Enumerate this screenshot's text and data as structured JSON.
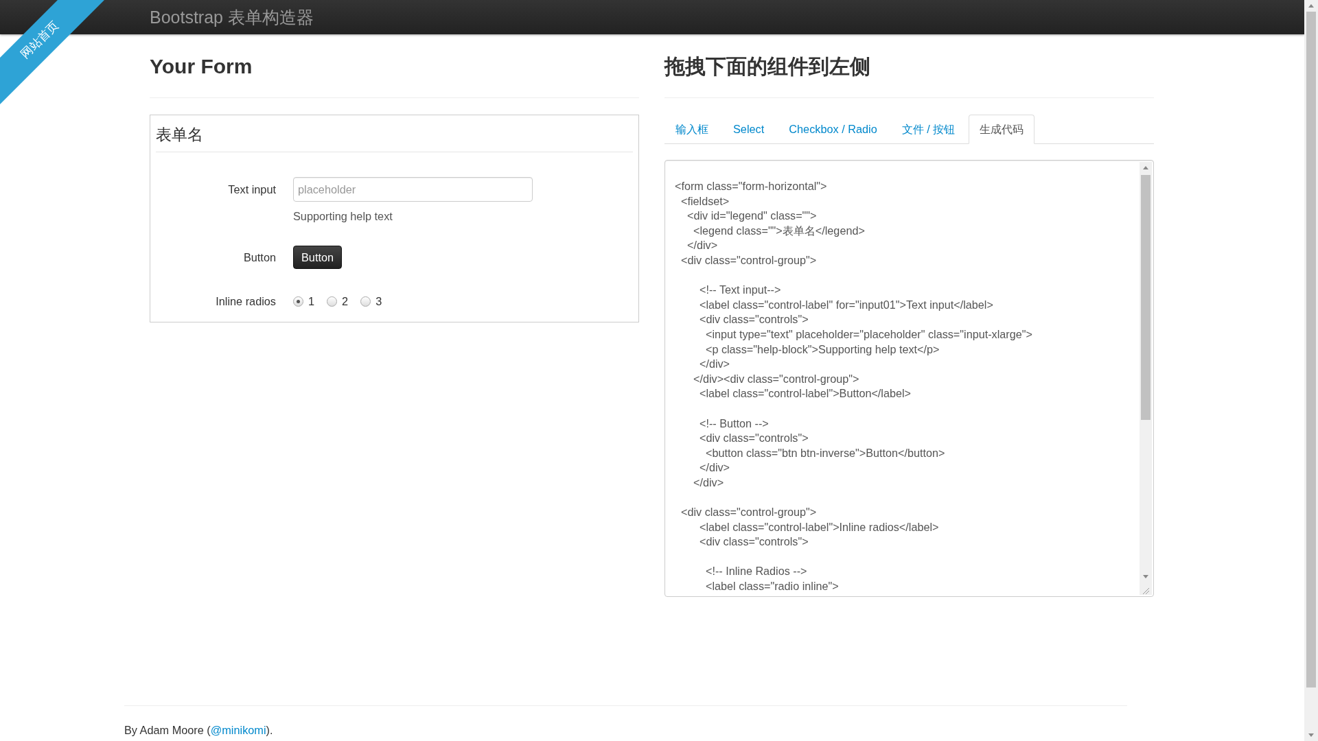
{
  "navbar": {
    "brand": "Bootstrap 表单构造器"
  },
  "ribbon": {
    "label": "网站首页"
  },
  "form_panel": {
    "heading": "Your Form",
    "legend": "表单名",
    "fields": [
      {
        "kind": "text",
        "label": "Text input",
        "placeholder": "placeholder",
        "help": "Supporting help text"
      },
      {
        "kind": "button",
        "label": "Button",
        "button": "Button"
      },
      {
        "kind": "radios",
        "label": "Inline radios",
        "options": [
          {
            "label": "1",
            "selected": true
          },
          {
            "label": "2",
            "selected": false
          },
          {
            "label": "3",
            "selected": false
          }
        ]
      }
    ]
  },
  "components_panel": {
    "heading": "拖拽下面的组件到左侧",
    "tabs": [
      {
        "label": "输入框",
        "selected": false
      },
      {
        "label": "Select",
        "selected": false
      },
      {
        "label": "Checkbox / Radio",
        "selected": false
      },
      {
        "label": "文件 / 按钮",
        "selected": false
      },
      {
        "label": "生成代码",
        "selected": true
      }
    ],
    "code": "<form class=\"form-horizontal\">\n  <fieldset>\n    <div id=\"legend\" class=\"\">\n      <legend class=\"\">表单名</legend>\n    </div>\n  <div class=\"control-group\">\n\n        <!-- Text input-->\n        <label class=\"control-label\" for=\"input01\">Text input</label>\n        <div class=\"controls\">\n          <input type=\"text\" placeholder=\"placeholder\" class=\"input-xlarge\">\n          <p class=\"help-block\">Supporting help text</p>\n        </div>\n      </div><div class=\"control-group\">\n        <label class=\"control-label\">Button</label>\n\n        <!-- Button -->\n        <div class=\"controls\">\n          <button class=\"btn btn-inverse\">Button</button>\n        </div>\n      </div>\n\n  <div class=\"control-group\">\n        <label class=\"control-label\">Inline radios</label>\n        <div class=\"controls\">\n\n          <!-- Inline Radios -->\n          <label class=\"radio inline\">"
  },
  "footer": {
    "prefix": "By Adam Moore (",
    "link": "@minikomi",
    "suffix": ")."
  }
}
